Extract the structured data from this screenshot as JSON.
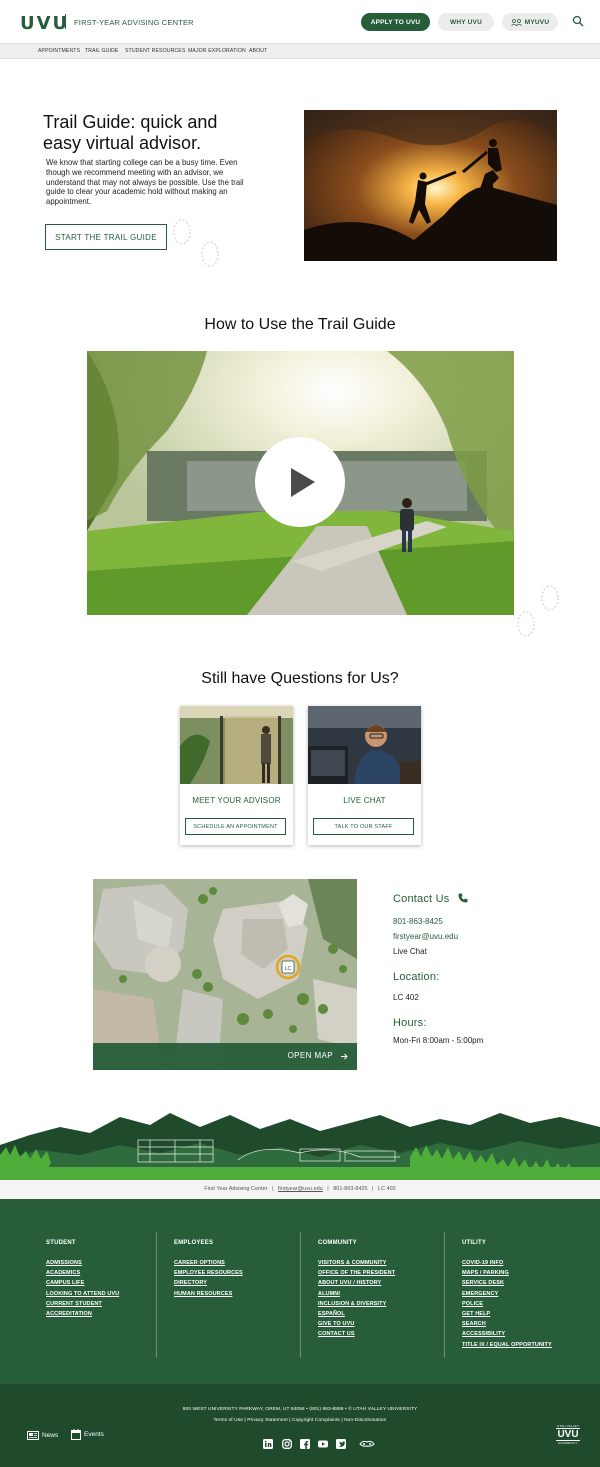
{
  "header": {
    "logo": "UVU",
    "dept": "FIRST-YEAR ADVISING CENTER",
    "apply": "APPLY TO UVU",
    "why": "WHY UVU",
    "myuvu": "MYUVU"
  },
  "subnav": [
    "APPOINTMENTS",
    "TRAIL GUIDE",
    "STUDENT RESOURCES",
    "MAJOR EXPLORATION",
    "ABOUT"
  ],
  "hero": {
    "title": "Trail Guide: quick and easy virtual advisor.",
    "body": "We know that starting college can be a busy time. Even though we recommend meeting with an advisor, we understand that may not always be possible. Use the trail guide to clear your academic hold without making an appointment.",
    "button": "START THE TRAIL GUIDE"
  },
  "video": {
    "heading": "How to Use the Trail Guide"
  },
  "questions": {
    "heading": "Still have Questions for Us?",
    "cards": [
      {
        "title": "MEET YOUR ADVISOR",
        "button": "SCHEDULE AN APPOINTMENT"
      },
      {
        "title": "LIVE CHAT",
        "button": "TALK TO OUR STAFF"
      }
    ]
  },
  "map": {
    "open": "OPEN MAP",
    "marker": "LC"
  },
  "contact": {
    "title": "Contact Us",
    "phone": "801-863-8425",
    "email": "firstyear@uvu.edu",
    "chat": "Live Chat",
    "location_title": "Location:",
    "location": "LC 402",
    "hours_title": "Hours:",
    "hours": "Mon-Fri 8:00am - 5:00pm"
  },
  "infobar": {
    "name": "First Year Advising Center",
    "email": "firstyear@uvu.edu",
    "phone": "801-863-8425",
    "room": "LC 402"
  },
  "footer": {
    "student": {
      "heading": "STUDENT",
      "links": [
        "ADMISSIONS",
        "ACADEMICS",
        "CAMPUS LIFE",
        "LOOKING TO ATTEND UVU",
        "CURRENT STUDENT",
        "ACCREDITATION"
      ]
    },
    "employees": {
      "heading": "EMPLOYEES",
      "links": [
        "CAREER OPTIONS",
        "EMPLOYEE RESOURCES",
        "DIRECTORY",
        "HUMAN RESOURCES"
      ]
    },
    "community": {
      "heading": "COMMUNITY",
      "links": [
        "VISITORS & COMMUNITY",
        "OFFICE OF THE PRESIDENT",
        "ABOUT UVU / HISTORY",
        "ALUMNI",
        "INCLUSION & DIVERSITY",
        "ESPAÑOL",
        "GIVE TO UVU",
        "CONTACT US"
      ]
    },
    "utility": {
      "heading": "UTILITY",
      "links": [
        "COVID-19 INFO",
        "MAPS / PARKING",
        "SERVICE DESK",
        "EMERGENCY",
        "POLICE",
        "GET HELP",
        "SEARCH",
        "ACCESSIBILITY",
        "TITLE IX / EQUAL OPPORTUNITY"
      ]
    },
    "address": "800 WEST UNIVERSITY PARKWAY, OREM, UT 84058 • (801) 863-8888 • © UTAH VALLEY UNIVERSITY",
    "legal": "Terms of Use  |  Privacy Statement  |  Copyright Complaints  |  Non-Discrimination",
    "news": "News",
    "events": "Events",
    "badge": "UVU",
    "badge_top": "UTAH VALLEY",
    "badge_bottom": "UNIVERSITY"
  },
  "colors": {
    "brand": "#275d38",
    "brand_dark": "#1f4a2c"
  }
}
